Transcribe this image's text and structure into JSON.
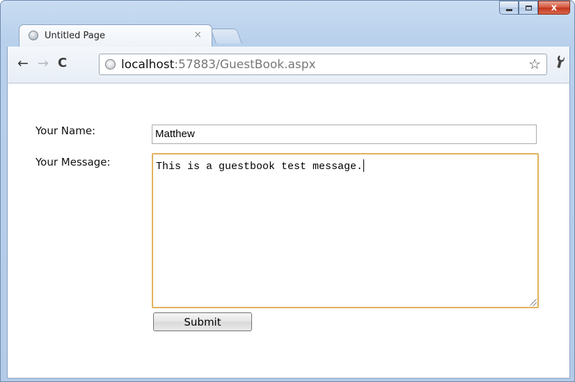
{
  "window": {
    "controls": {
      "minimize": "–",
      "maximize": "□",
      "close": "x"
    }
  },
  "tab": {
    "title": "Untitled Page",
    "close_glyph": "×",
    "favicon_icon": "globe-icon"
  },
  "toolbar": {
    "back_glyph": "←",
    "forward_glyph": "→",
    "reload_glyph": "C",
    "url_host": "localhost",
    "url_rest": ":57883/GuestBook.aspx",
    "star_glyph": "☆",
    "wrench_glyph": "🔧"
  },
  "form": {
    "name_label": "Your Name:",
    "name_value": "Matthew",
    "message_label": "Your Message:",
    "message_value": "This is a guestbook test message.",
    "submit_label": "Submit"
  },
  "colors": {
    "focus_border": "#e0b15b",
    "close_button": "#c9452b",
    "frame": "#b8d0ec"
  }
}
